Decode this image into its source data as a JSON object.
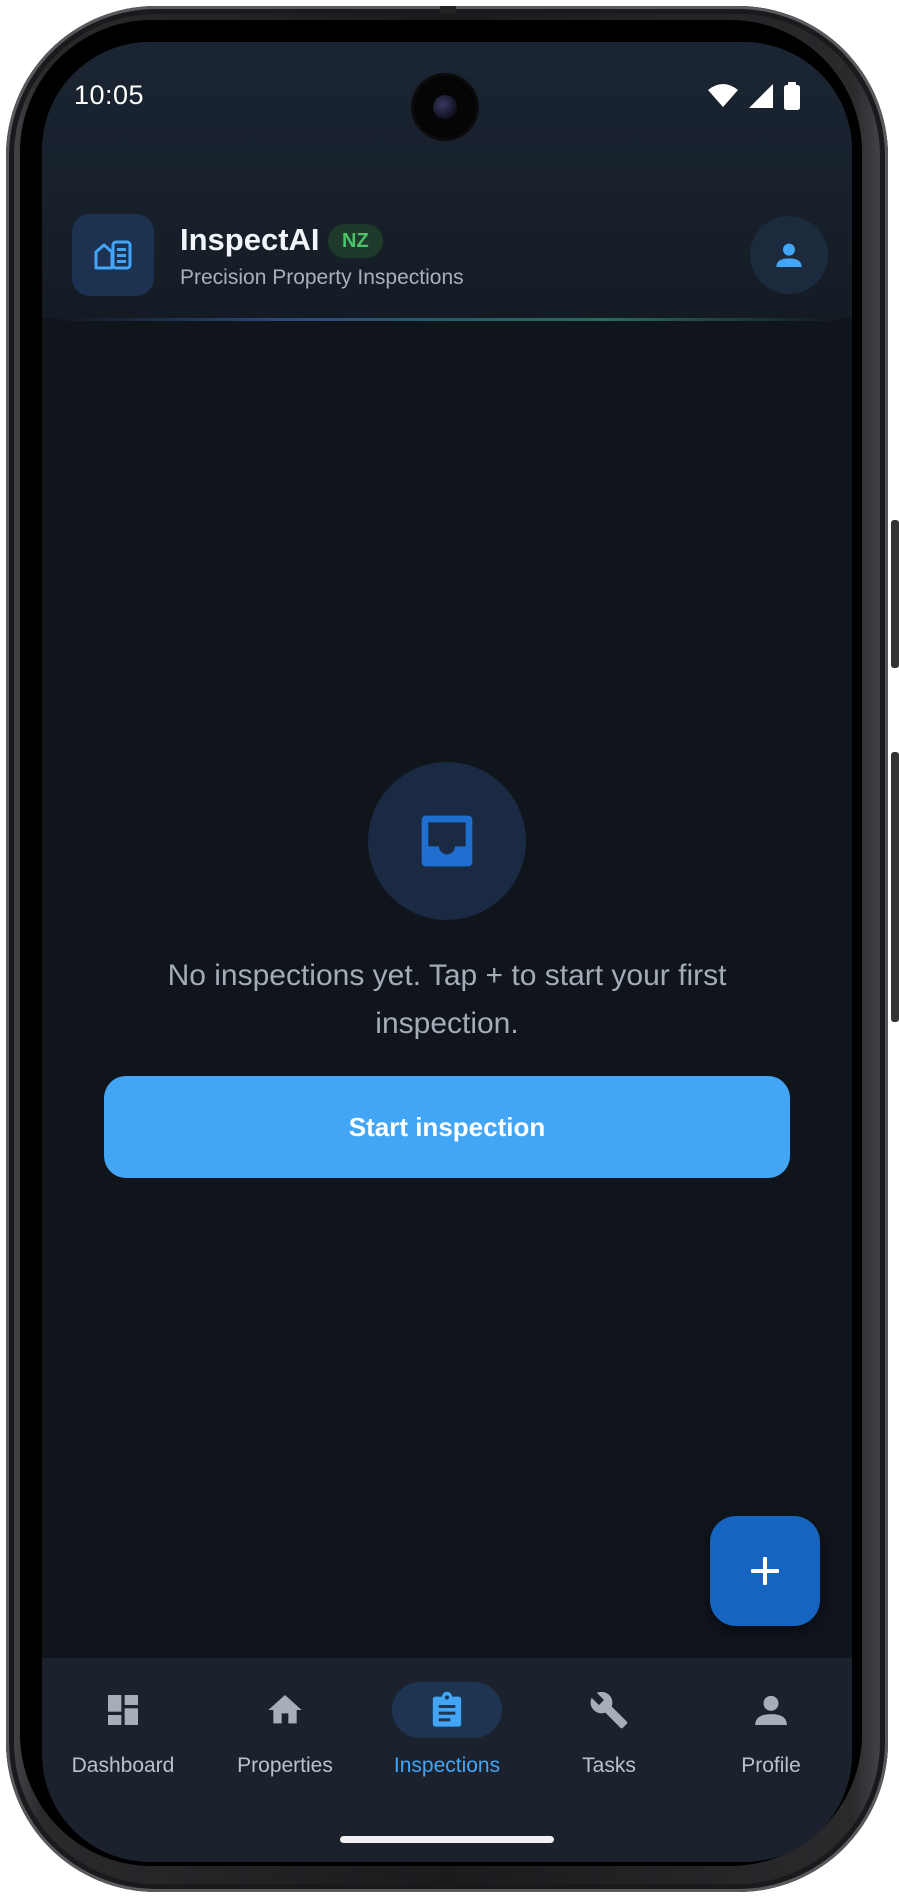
{
  "status_bar": {
    "time": "10:05",
    "icons": [
      "wifi-icon",
      "signal-icon",
      "battery-icon"
    ]
  },
  "header": {
    "title": "InspectAI",
    "region": "NZ",
    "subtitle": "Precision Property Inspections",
    "logo_icon": "inspection-app-logo-icon",
    "account_icon": "person-icon"
  },
  "empty_state": {
    "icon": "inbox-tray-icon",
    "message": "No inspections yet. Tap + to start your first inspection.",
    "button_label": "Start inspection"
  },
  "fab": {
    "icon": "plus-icon"
  },
  "bottom_nav": {
    "active": "Inspections",
    "items": [
      {
        "label": "Dashboard",
        "icon": "dashboard-icon"
      },
      {
        "label": "Properties",
        "icon": "home-icon"
      },
      {
        "label": "Inspections",
        "icon": "clipboard-icon"
      },
      {
        "label": "Tasks",
        "icon": "wrench-icon"
      },
      {
        "label": "Profile",
        "icon": "person-icon"
      }
    ]
  },
  "colors": {
    "background": "#10141b",
    "accent": "#42a5f5",
    "fab": "#1565c0",
    "badge_text": "#4cc26a"
  }
}
